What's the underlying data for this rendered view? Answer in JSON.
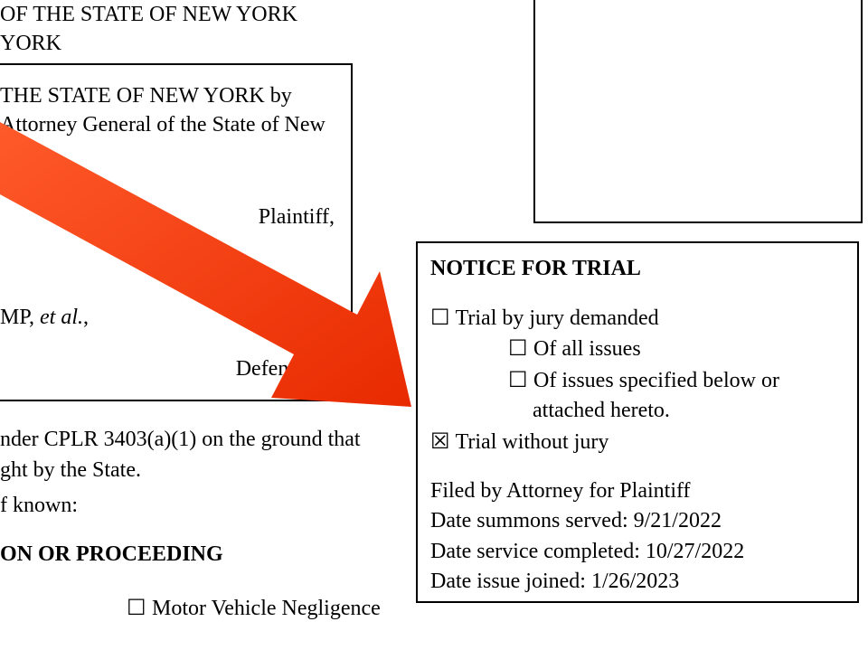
{
  "court": {
    "line1": "OF THE STATE OF NEW YORK",
    "line2": "YORK"
  },
  "caption": {
    "party1_line1": "THE STATE OF NEW YORK by",
    "party1_line2": "Attorney General of the State of New",
    "plaintiff_label": "Plaintiff,",
    "party2_prefix": "MP, ",
    "party2_suffix": "et al.",
    "party2_comma": ",",
    "defendants_label": "Defendants"
  },
  "body": {
    "cplr_line1": "nder CPLR 3403(a)(1) on the ground that",
    "cplr_line2": "ght by the State.",
    "known": "f known:",
    "section_heading": "ON OR PROCEEDING",
    "motor_vehicle": " Motor Vehicle Negligence"
  },
  "notice": {
    "title": "NOTICE FOR TRIAL",
    "jury_demanded": " Trial by jury demanded",
    "all_issues": " Of all issues",
    "issues_specified_l1": " Of issues specified below or",
    "issues_specified_l2": "attached hereto.",
    "without_jury": " Trial without jury",
    "filed_by": "Filed by Attorney for Plaintiff",
    "date_summons": "Date summons served: 9/21/2022",
    "date_service": "Date service completed: 10/27/2022",
    "date_issue": "Date issue joined:  1/26/2023"
  },
  "glyph": {
    "unchecked": "☐",
    "checked": "☒"
  },
  "arrow": {
    "color": "#ff3b18"
  }
}
